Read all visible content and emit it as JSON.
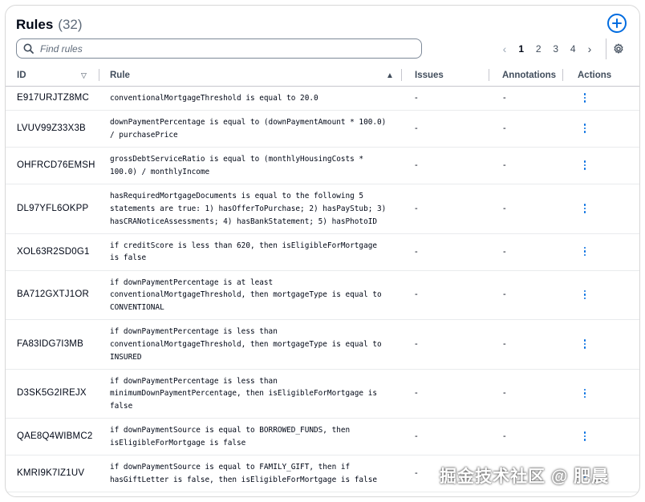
{
  "header": {
    "title": "Rules",
    "count": "(32)"
  },
  "search": {
    "placeholder": "Find rules",
    "value": ""
  },
  "pagination": {
    "pages": [
      "1",
      "2",
      "3",
      "4"
    ],
    "current": "1",
    "prev": "‹",
    "next": "›"
  },
  "columns": {
    "id": "ID",
    "rule": "Rule",
    "issues": "Issues",
    "annotations": "Annotations",
    "actions": "Actions"
  },
  "rows": [
    {
      "id": "E917URJTZ8MC",
      "rule": [
        "conventionalMortgageThreshold is equal to 20.0"
      ],
      "issues": "-",
      "annotations": "-"
    },
    {
      "id": "LVUV99Z33X3B",
      "rule": [
        "downPaymentPercentage is equal to (downPaymentAmount * 100.0)",
        "/ purchasePrice"
      ],
      "issues": "-",
      "annotations": "-"
    },
    {
      "id": "OHFRCD76EMSH",
      "rule": [
        "grossDebtServiceRatio is equal to (monthlyHousingCosts *",
        "100.0) / monthlyIncome"
      ],
      "issues": "-",
      "annotations": "-"
    },
    {
      "id": "DL97YFL6OKPP",
      "rule": [
        "hasRequiredMortgageDocuments is equal to the following 5",
        "statements are true: 1) hasOfferToPurchase; 2) hasPayStub; 3)",
        "hasCRANoticeAssessments; 4) hasBankStatement; 5) hasPhotoID"
      ],
      "issues": "-",
      "annotations": "-"
    },
    {
      "id": "XOL63R2SD0G1",
      "rule": [
        "if creditScore is less than 620, then isEligibleForMortgage",
        "is false"
      ],
      "issues": "-",
      "annotations": "-"
    },
    {
      "id": "BA712GXTJ1OR",
      "rule": [
        "if downPaymentPercentage is at least",
        "conventionalMortgageThreshold, then mortgageType is equal to",
        "CONVENTIONAL"
      ],
      "issues": "-",
      "annotations": "-"
    },
    {
      "id": "FA83IDG7I3MB",
      "rule": [
        "if downPaymentPercentage is less than",
        "conventionalMortgageThreshold, then mortgageType is equal to",
        "INSURED"
      ],
      "issues": "-",
      "annotations": "-"
    },
    {
      "id": "D3SK5G2IREJX",
      "rule": [
        "if downPaymentPercentage is less than",
        "minimumDownPaymentPercentage, then isEligibleForMortgage is",
        "false"
      ],
      "issues": "-",
      "annotations": "-"
    },
    {
      "id": "QAE8Q4WIBMC2",
      "rule": [
        "if downPaymentSource is equal to BORROWED_FUNDS, then",
        "isEligibleForMortgage is false"
      ],
      "issues": "-",
      "annotations": "-"
    },
    {
      "id": "KMRI9K7IZ1UV",
      "rule": [
        "if downPaymentSource is equal to FAMILY_GIFT, then if",
        "hasGiftLetter is false, then isEligibleForMortgage is false"
      ],
      "issues": "-",
      "annotations": ""
    }
  ],
  "watermark": "掘金技术社区 @ 肥晨",
  "colors": {
    "accent": "#006ce0",
    "text": "#000716",
    "muted": "#5f6b7a",
    "border": "#c6c6cd"
  },
  "icons": {
    "add": "plus-circle-icon",
    "search": "search-icon",
    "settings": "gear-icon",
    "actions": "kebab-menu-icon",
    "sort": "sort-triangle-icon"
  }
}
